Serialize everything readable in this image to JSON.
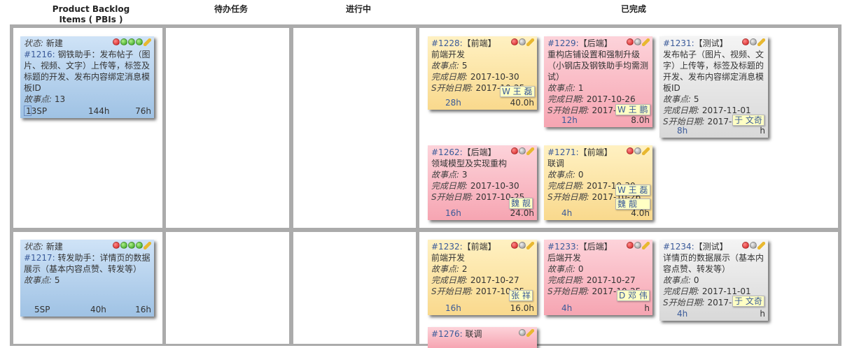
{
  "headers": [
    "Product Backlog Items ( PBIs )",
    "待办任务",
    "进行中",
    "已完成"
  ],
  "labels": {
    "status": "状态:",
    "story_points": "故事点:",
    "done_date": "完成日期:",
    "start_date": "S开始日期:"
  },
  "rows": [
    {
      "pbi": {
        "status": "新建",
        "id": "#1216:",
        "title": "钢铁助手：发布帖子（图片、视频、文字）上传等，标签及标题的开发、发布内容绑定消息模板ID",
        "story_points": "13",
        "sp": "13SP",
        "hours1": "144h",
        "hours2": "76h"
      },
      "done": [
        {
          "id": "#1228:",
          "type": "【前端】",
          "title": "前端开发",
          "sp": "5",
          "done": "2017-10-30",
          "start": "2017-10-25",
          "est": "28h",
          "remain": "40.0h",
          "assignee": "W 王 磊"
        },
        {
          "id": "#1229:",
          "type": "【后端】",
          "title": "重构店铺设置和强制升级（小钢店及钢铁助手均需测试）",
          "sp": "1",
          "done": "2017-10-26",
          "start": "2017-10-26",
          "est": "12h",
          "remain": "8.0h",
          "assignee": "W 王 鹏"
        },
        {
          "id": "#1231:",
          "type": "【测试】",
          "title": "发布帖子（图片、视频、文字）上传等，标签及标题的开发、发布内容绑定消息模板ID",
          "sp": "5",
          "done": "2017-11-01",
          "start": "2017-10-30",
          "est": "8h",
          "remain": "h",
          "assignee": "于 文奇"
        },
        {
          "id": "#1262:",
          "type": "【后端】",
          "title": "领域模型及实现重构",
          "sp": "3",
          "done": "2017-10-30",
          "start": "2017-10-25",
          "est": "16h",
          "remain": "24.0h",
          "assignee": "魏 靓"
        },
        {
          "id": "#1271:",
          "type": "【前端】",
          "title": "联调",
          "sp": "0",
          "done": "2017-10-30",
          "start": "2017-10-26",
          "est": "4h",
          "remain": "4.0h",
          "assignee": "W 王 磊",
          "assignee2": "魏 靓"
        }
      ]
    },
    {
      "pbi": {
        "status": "新建",
        "id": "#1217:",
        "title": "转发助手：详情页的数据展示（基本内容点赞、转发等）",
        "story_points": "5",
        "sp": "5SP",
        "hours1": "40h",
        "hours2": "16h"
      },
      "done": [
        {
          "id": "#1232:",
          "type": "【前端】",
          "title": "前端开发",
          "sp": "2",
          "done": "2017-10-27",
          "start": "2017-10-25",
          "est": "16h",
          "remain": "16.0h",
          "assignee": "张 祥"
        },
        {
          "id": "#1233:",
          "type": "【后端】",
          "title": "后端开发",
          "sp": "0",
          "done": "2017-10-27",
          "start": "2017-10-25",
          "est": "4h",
          "remain": "h",
          "assignee": "D 邓 伟"
        },
        {
          "id": "#1234:",
          "type": "【测试】",
          "title": "详情页的数据展示（基本内容点赞、转发等）",
          "sp": "0",
          "done": "2017-11-01",
          "start": "2017-10-30",
          "est": "4h",
          "remain": "h",
          "assignee": "于 文奇"
        },
        {
          "id": "#1276:",
          "type": "",
          "title": "联调"
        }
      ]
    }
  ]
}
